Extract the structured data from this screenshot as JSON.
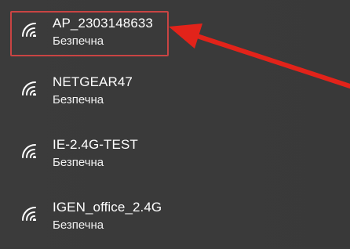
{
  "networks": [
    {
      "ssid": "AP_2303148633",
      "status": "Безпечна",
      "icon": "wifi-signal-icon",
      "selected": true
    },
    {
      "ssid": "NETGEAR47",
      "status": "Безпечна",
      "icon": "wifi-signal-icon"
    },
    {
      "ssid": "IE-2.4G-TEST",
      "status": "Безпечна",
      "icon": "wifi-signal-icon"
    },
    {
      "ssid": "IGEN_office_2.4G",
      "status": "Безпечна",
      "icon": "wifi-signal-icon"
    }
  ],
  "colors": {
    "background": "#3a3a3a",
    "text": "#ffffff",
    "highlight_border": "#c94443",
    "arrow": "#e2231a"
  }
}
